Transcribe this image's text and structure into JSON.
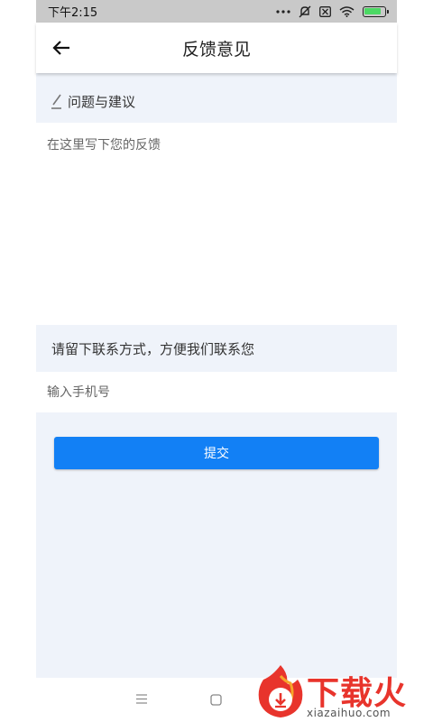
{
  "status_bar": {
    "time": "下午2:15",
    "icons": [
      "more-dots-icon",
      "mute-icon",
      "sim-icon",
      "wifi-icon",
      "battery-icon"
    ],
    "battery_level": 0.76
  },
  "app_bar": {
    "back_icon": "arrow-left-icon",
    "title": "反馈意见"
  },
  "feedback_section": {
    "icon": "pencil-icon",
    "label": "问题与建议",
    "placeholder": "在这里写下您的反馈"
  },
  "contact_section": {
    "label": "请留下联系方式，方便我们联系您",
    "placeholder": "输入手机号"
  },
  "submit": {
    "label": "提交"
  },
  "nav_bar": {
    "icons": [
      "menu-icon",
      "home-square-icon"
    ]
  },
  "watermark": {
    "brand": "下载火",
    "domain": "xiazaihuo.com"
  },
  "colors": {
    "accent": "#1280f5",
    "page_bg": "#eff3fa",
    "watermark": "#e8342c"
  }
}
